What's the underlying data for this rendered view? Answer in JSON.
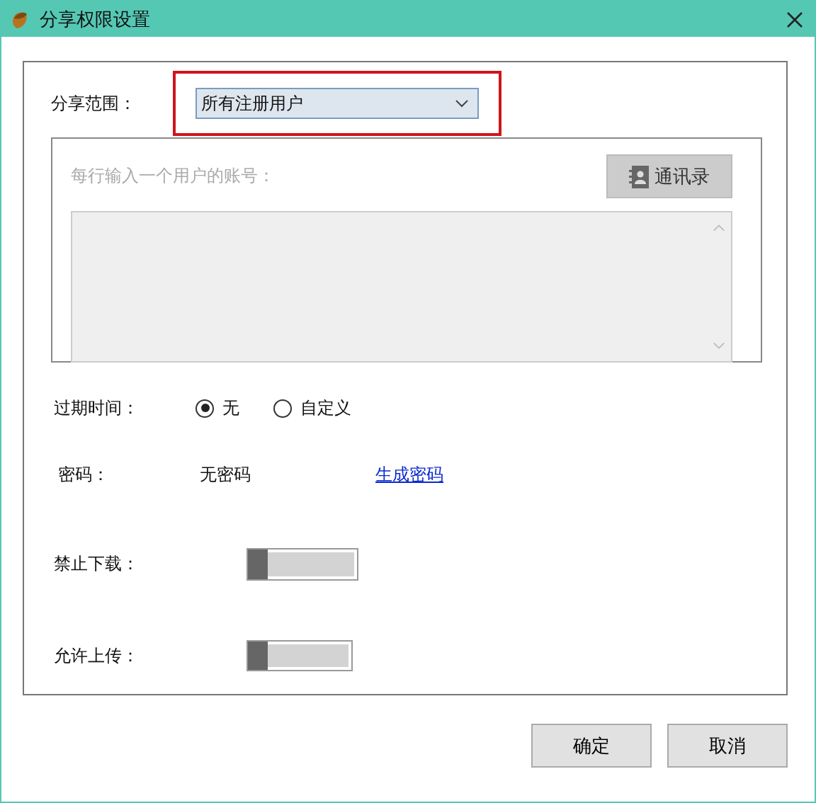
{
  "window": {
    "title": "分享权限设置"
  },
  "scope": {
    "label": "分享范围：",
    "value": "所有注册用户",
    "highlighted": true
  },
  "accounts": {
    "hint": "每行输入一个用户的账号：",
    "contacts_button": "通讯录",
    "disabled": true
  },
  "expiry": {
    "label": "过期时间：",
    "options": [
      {
        "label": "无",
        "selected": true
      },
      {
        "label": "自定义",
        "selected": false
      }
    ]
  },
  "password": {
    "label": "密码：",
    "value": "无密码",
    "link": "生成密码"
  },
  "toggles": [
    {
      "label": "禁止下载：",
      "on": false
    },
    {
      "label": "允许上传：",
      "on": false
    }
  ],
  "buttons": [
    "确定",
    "取消"
  ]
}
